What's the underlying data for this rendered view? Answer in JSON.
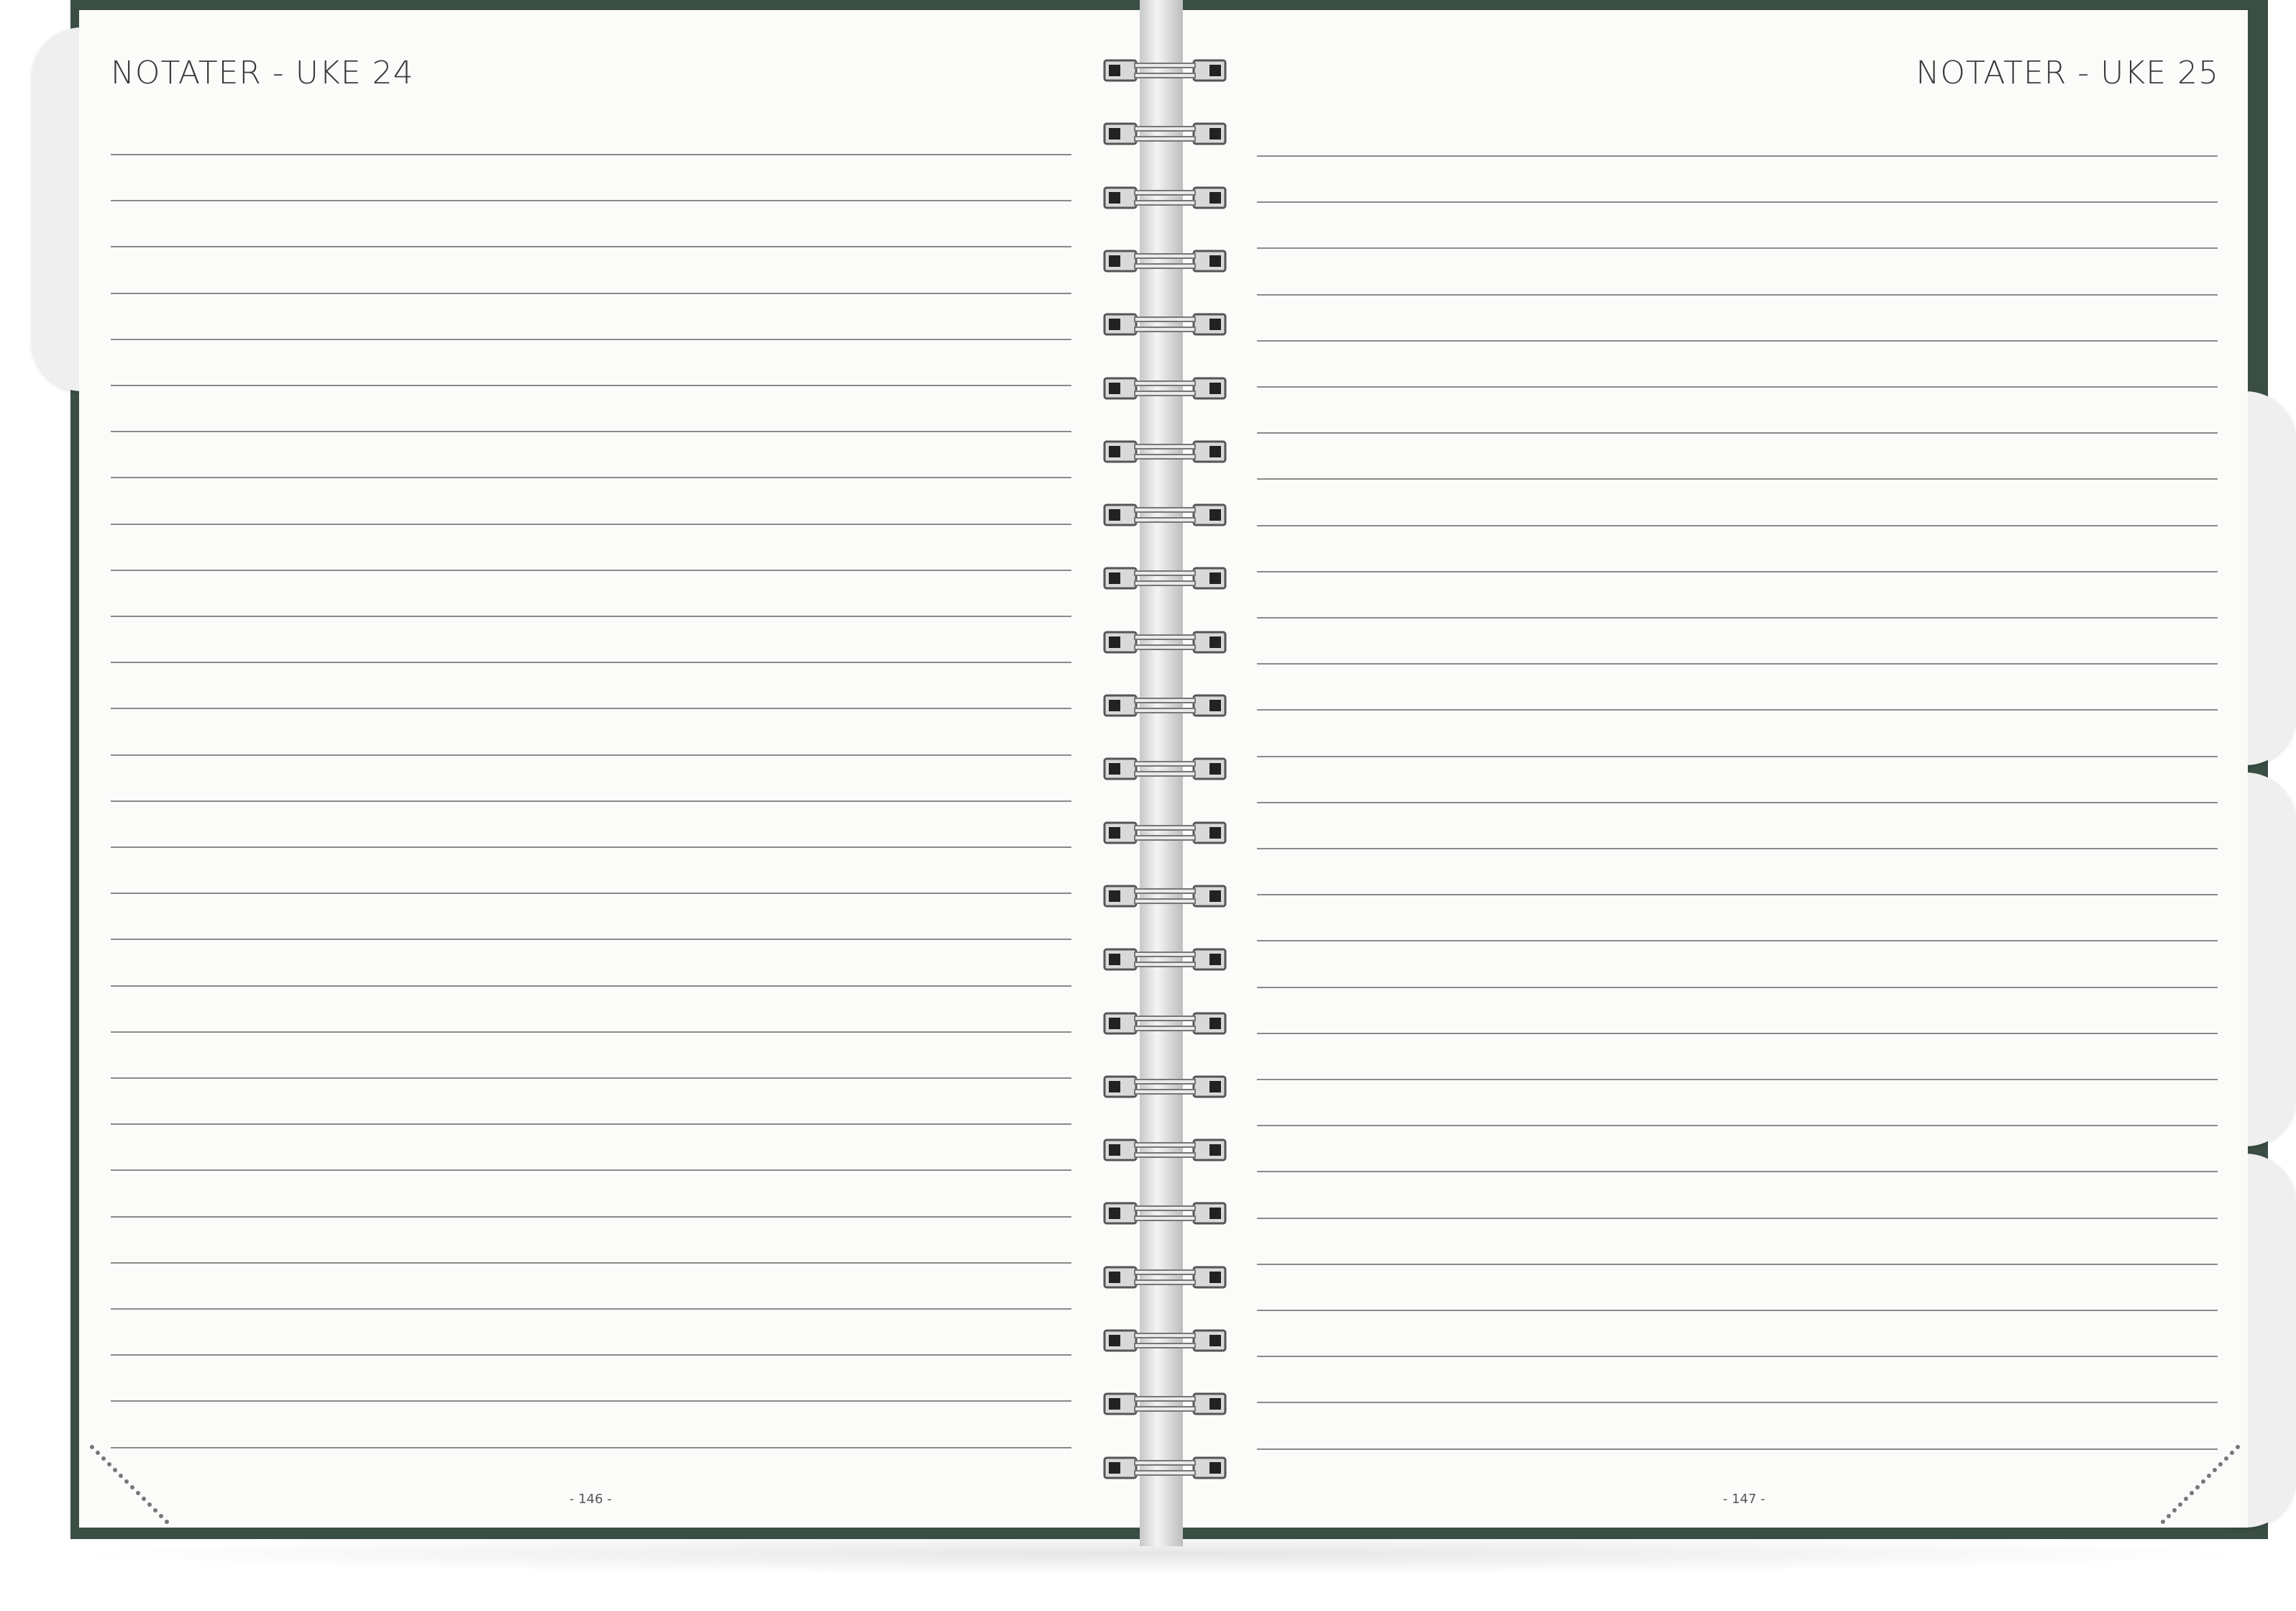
{
  "left_page": {
    "title": "NOTATER - UKE 24",
    "page_number": "- 146 -"
  },
  "right_page": {
    "title": "NOTATER - UKE 25",
    "page_number": "- 147 -"
  },
  "colors": {
    "cover": "#3a4e44",
    "page": "#fbfbf9",
    "rule": "#8a8a8a",
    "tab": "#efefef"
  },
  "icons": [
    "spiral-binding-icon",
    "corner-dot-guide-icon"
  ]
}
